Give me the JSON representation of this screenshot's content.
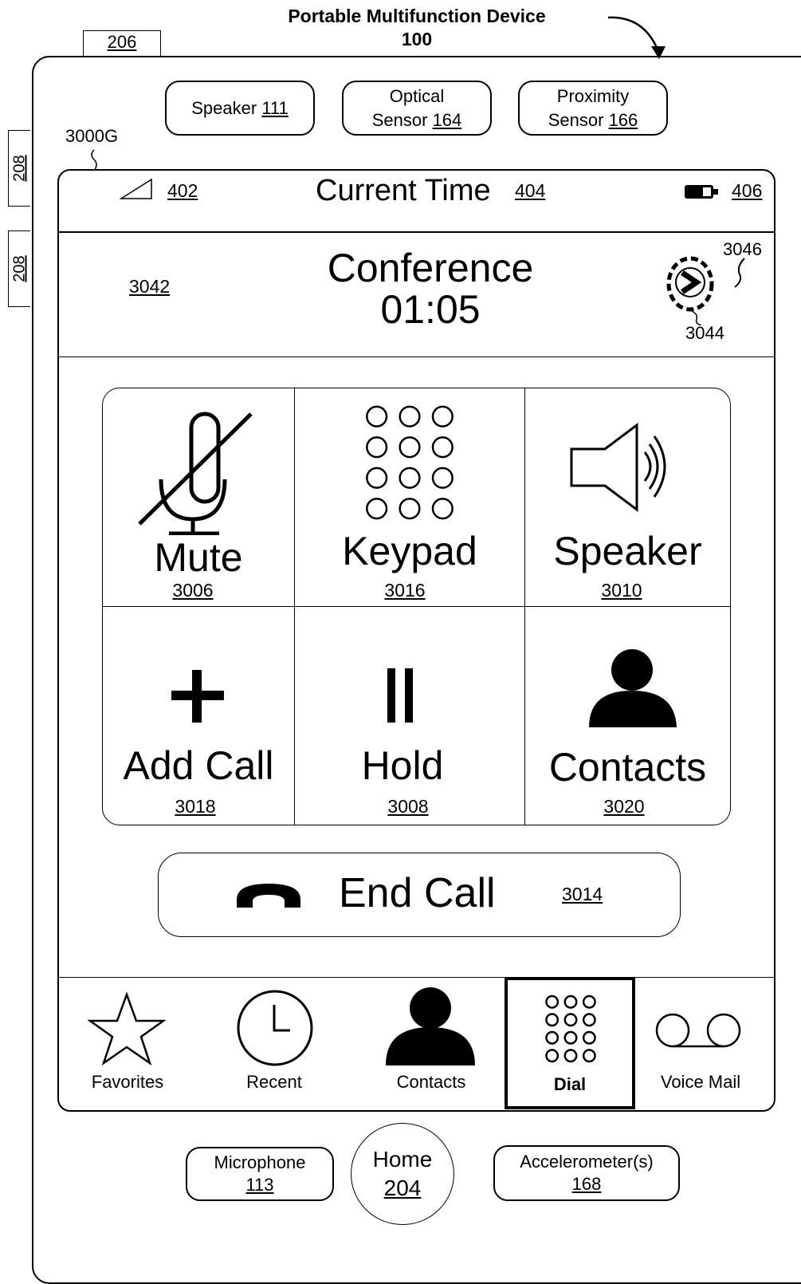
{
  "figure": {
    "title": "Portable Multifunction Device",
    "device_ref": "100",
    "tab_ref": "206",
    "side_button_refs": [
      "208",
      "208"
    ],
    "screen_ref": "3000G"
  },
  "hardware_top": [
    {
      "label": "Speaker",
      "ref": "111"
    },
    {
      "label": "Optical",
      "label2": "Sensor",
      "ref": "164"
    },
    {
      "label": "Proximity",
      "label2": "Sensor",
      "ref": "166"
    }
  ],
  "status_bar": {
    "signal_ref": "402",
    "time_label": "Current Time",
    "time_ref": "404",
    "battery_ref": "406"
  },
  "call_header": {
    "area_ref": "3042",
    "title": "Conference",
    "duration": "01:05",
    "arrow_ref": "3046",
    "region_ref": "3044"
  },
  "controls": [
    {
      "label": "Mute",
      "ref": "3006",
      "icon": "microphone-off-icon"
    },
    {
      "label": "Keypad",
      "ref": "3016",
      "icon": "keypad-icon"
    },
    {
      "label": "Speaker",
      "ref": "3010",
      "icon": "speaker-icon"
    },
    {
      "label": "Add Call",
      "ref": "3018",
      "icon": "plus-icon"
    },
    {
      "label": "Hold",
      "ref": "3008",
      "icon": "pause-icon"
    },
    {
      "label": "Contacts",
      "ref": "3020",
      "icon": "person-icon"
    }
  ],
  "end_call": {
    "label": "End Call",
    "ref": "3014",
    "icon": "phone-hangup-icon"
  },
  "tab_bar": [
    {
      "label": "Favorites",
      "icon": "star-icon"
    },
    {
      "label": "Recent",
      "icon": "clock-icon"
    },
    {
      "label": "Contacts",
      "icon": "person-icon"
    },
    {
      "label": "Dial",
      "icon": "keypad-icon",
      "selected": true
    },
    {
      "label": "Voice Mail",
      "icon": "voicemail-icon"
    }
  ],
  "hardware_bottom": {
    "microphone": {
      "label": "Microphone",
      "ref": "113"
    },
    "home": {
      "label": "Home",
      "ref": "204"
    },
    "accelerometer": {
      "label": "Accelerometer(s)",
      "ref": "168"
    }
  }
}
